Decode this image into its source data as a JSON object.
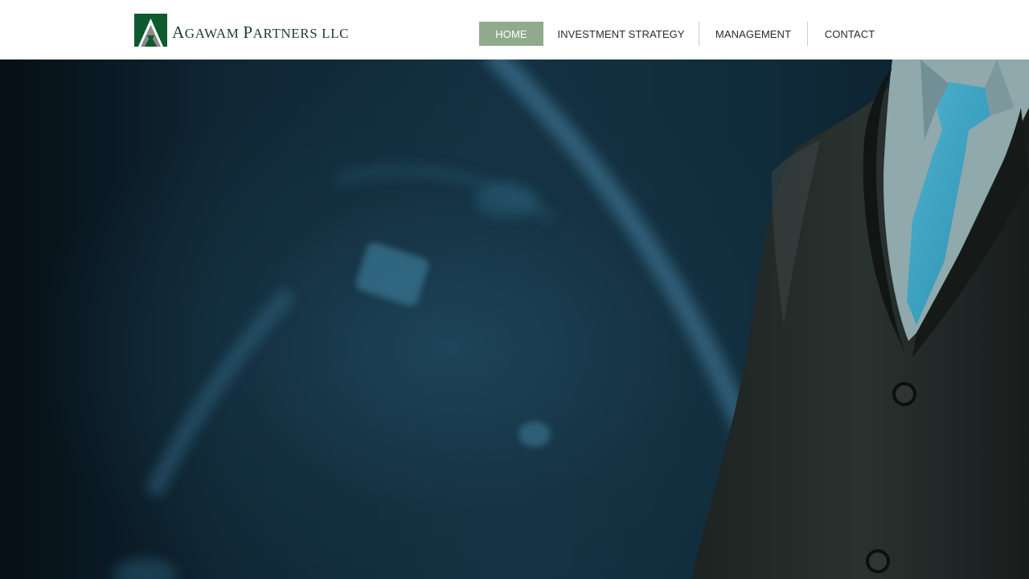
{
  "brand": {
    "name_first_cap": "A",
    "name_first_rest": "GAWAM ",
    "name_second_cap": "P",
    "name_second_rest": "ARTNERS LLC",
    "logo_icon": "mountain-triangle-logo",
    "colors": {
      "logo_green": "#0d5a2c",
      "logo_gray": "#8a8a8a",
      "text": "#1f3a2a"
    }
  },
  "nav": {
    "items": [
      {
        "label": "HOME",
        "active": true
      },
      {
        "label": "INVESTMENT STRATEGY",
        "active": false
      },
      {
        "label": "MANAGEMENT",
        "active": false
      },
      {
        "label": "CONTACT",
        "active": false
      }
    ],
    "active_color": "#8fab8c"
  },
  "hero": {
    "image": "businessman-in-suit-with-teal-tie-against-dark-blue-background"
  }
}
